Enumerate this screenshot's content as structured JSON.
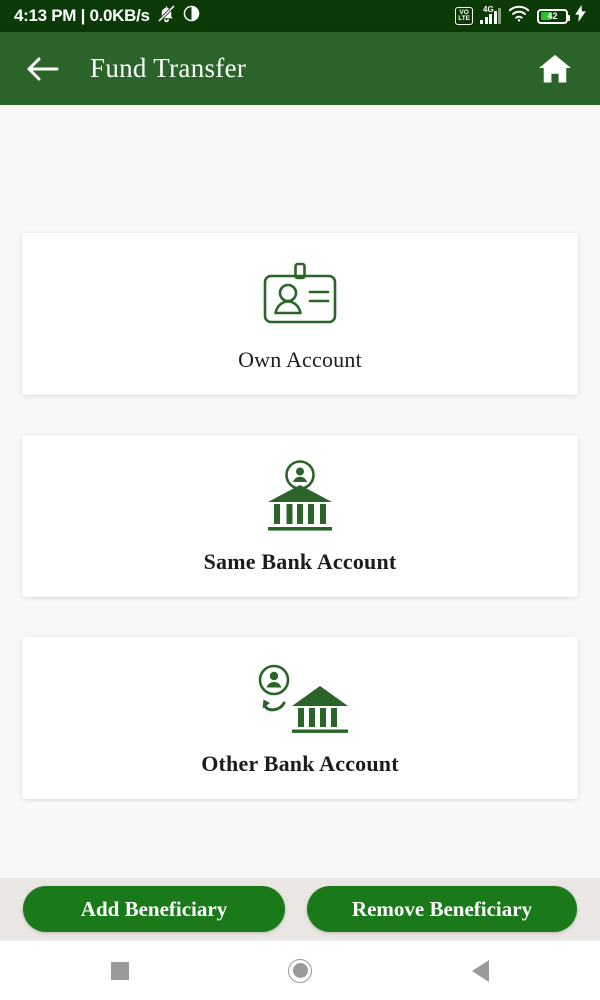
{
  "status_bar": {
    "text": "4:13 PM | 0.0KB/s",
    "dnd_icon": "bell-muted-icon",
    "contrast_icon": "contrast-circle-icon",
    "volte_label_top": "VO",
    "volte_label_bottom": "LTE",
    "network_type": "4G",
    "wifi_icon": "wifi-icon",
    "battery_level": "42",
    "charging_icon": "charging-bolt-icon",
    "bg_color": "#0b3a06"
  },
  "app_bar": {
    "title": "Fund Transfer",
    "back_icon": "arrow-left-icon",
    "home_icon": "home-icon",
    "bg_color": "#2a6428"
  },
  "cards": [
    {
      "id": "own-account",
      "label": "Own Account",
      "icon": "id-badge-icon",
      "bold": false
    },
    {
      "id": "same-bank-account",
      "label": "Same Bank Account",
      "icon": "bank-with-person-icon",
      "bold": true
    },
    {
      "id": "other-bank-account",
      "label": "Other Bank Account",
      "icon": "bank-transfer-person-icon",
      "bold": true
    }
  ],
  "actions": {
    "add_label": "Add Beneficiary",
    "remove_label": "Remove Beneficiary",
    "button_color": "#1a7a1a",
    "bar_color": "#e9e6e3"
  },
  "nav_bar": {
    "recents_icon": "square-recents-icon",
    "home_icon": "circle-home-icon",
    "back_icon": "triangle-back-icon"
  },
  "theme": {
    "page_bg": "#f8f8f8",
    "card_bg": "#ffffff",
    "icon_stroke": "#2a6428",
    "label_color": "#1c1c1c"
  }
}
